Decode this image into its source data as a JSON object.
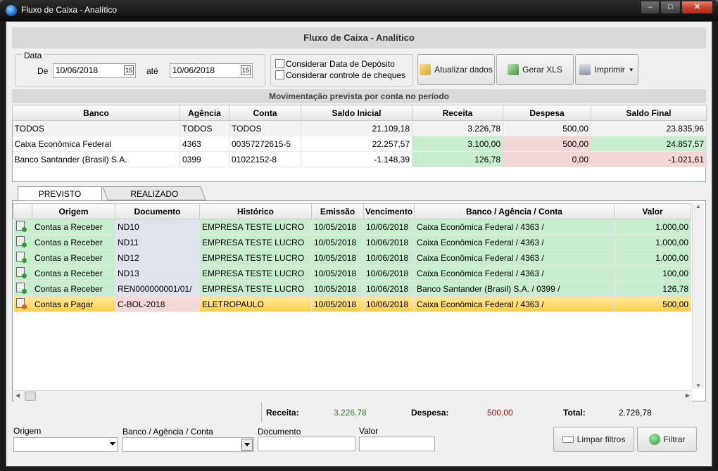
{
  "window": {
    "title": "Fluxo de Caixa - Analítico",
    "header": "Fluxo de Caixa - Analítico"
  },
  "filters": {
    "group_label": "Data",
    "from_label": "De",
    "from_date": "10/06/2018",
    "to_label": "até",
    "to_date": "10/06/2018",
    "check_deposit": "Considerar Data de Depósito",
    "check_cheques": "Considerar controle de cheques"
  },
  "buttons": {
    "refresh": "Atualizar dados",
    "xls": "Gerar XLS",
    "print": "Imprimir",
    "clear": "Limpar filtros",
    "filter": "Filtrar"
  },
  "summary": {
    "title": "Movimentação prevista por conta no período",
    "columns": [
      "Banco",
      "Agência",
      "Conta",
      "Saldo Inicial",
      "Receita",
      "Despesa",
      "Saldo Final"
    ],
    "rows": [
      [
        "TODOS",
        "TODOS",
        "TODOS",
        "21.109,18",
        "3.226,78",
        "500,00",
        "23.835,96"
      ],
      [
        "Caixa Econômica Federal",
        "4363",
        "00357272615-5",
        "22.257,57",
        "3.100,00",
        "500,00",
        "24.857,57"
      ],
      [
        "Banco Santander (Brasil) S.A.",
        "0399",
        "01022152-8",
        "-1.148,39",
        "126,78",
        "0,00",
        "-1.021,61"
      ]
    ]
  },
  "tabs": [
    "PREVISTO",
    "REALIZADO"
  ],
  "grid": {
    "columns": [
      "Origem",
      "Documento",
      "Histórico",
      "Emissão",
      "Vencimento",
      "Banco / Agência / Conta",
      "Valor"
    ],
    "rows": [
      [
        "Contas a Receber",
        "ND10",
        "EMPRESA TESTE LUCRO",
        "10/05/2018",
        "10/06/2018",
        "Caixa Econômica Federal / 4363 /",
        "1.000,00"
      ],
      [
        "Contas a Receber",
        "ND11",
        "EMPRESA TESTE LUCRO",
        "10/05/2018",
        "10/06/2018",
        "Caixa Econômica Federal / 4363 /",
        "1.000,00"
      ],
      [
        "Contas a Receber",
        "ND12",
        "EMPRESA TESTE LUCRO",
        "10/05/2018",
        "10/06/2018",
        "Caixa Econômica Federal / 4363 /",
        "1.000,00"
      ],
      [
        "Contas a Receber",
        "ND13",
        "EMPRESA TESTE LUCRO",
        "10/05/2018",
        "10/06/2018",
        "Caixa Econômica Federal / 4363 /",
        "100,00"
      ],
      [
        "Contas a Receber",
        "REN000000001/01/",
        "EMPRESA TESTE LUCRO",
        "10/05/2018",
        "10/06/2018",
        "Banco Santander (Brasil) S.A. / 0399 /",
        "126,78"
      ],
      [
        "Contas a Pagar",
        "C-BOL-2018",
        "ELETROPAULO",
        "10/05/2018",
        "10/06/2018",
        "Caixa Econômica Federal / 4363 /",
        "500,00"
      ]
    ]
  },
  "totals": {
    "receita_label": "Receita:",
    "receita": "3.226,78",
    "despesa_label": "Despesa:",
    "despesa": "500,00",
    "total_label": "Total:",
    "total": "2.726,78"
  },
  "bottom_filters": {
    "origem_label": "Origem",
    "banco_label": "Banco / Agência / Conta",
    "documento_label": "Documento",
    "valor_label": "Valor"
  },
  "colors": {
    "green_cell": "#c8ecce",
    "red_cell": "#f3d6d6",
    "selected_row": "#ffcf4e",
    "receita_text": "#2e7d32",
    "despesa_text": "#a01818"
  }
}
